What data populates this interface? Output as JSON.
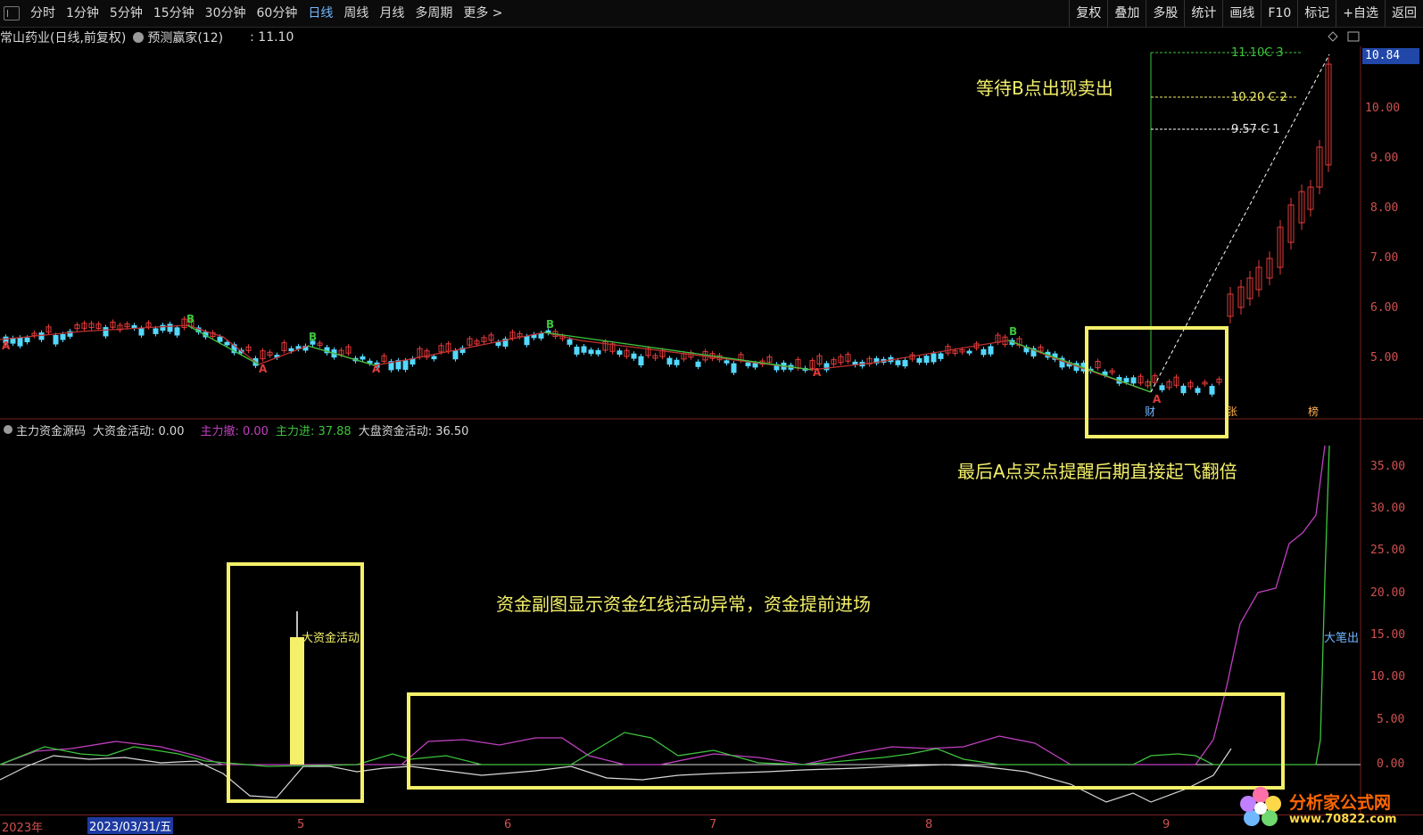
{
  "toolbar": {
    "periods": [
      "分时",
      "1分钟",
      "5分钟",
      "15分钟",
      "30分钟",
      "60分钟",
      "日线",
      "周线",
      "月线",
      "多周期",
      "更多 >"
    ],
    "active_period": "日线",
    "right_buttons": [
      "复权",
      "叠加",
      "多股",
      "统计",
      "画线",
      "F10",
      "标记",
      "+自选",
      "返回"
    ]
  },
  "info": {
    "stock_title": "常山药业(日线,前复权)",
    "indicator_name": "预测赢家(12)",
    "indicator_value": ": 11.10"
  },
  "price_box": "10.84",
  "price_axis": [
    "10.00",
    "9.00",
    "8.00",
    "7.00",
    "6.00",
    "5.00"
  ],
  "targets": [
    {
      "label": "11.10C 3",
      "value": 11.1
    },
    {
      "label": "10.20 C 2",
      "value": 10.2
    },
    {
      "label": "9.57 C 1",
      "value": 9.57
    }
  ],
  "signal_labels": {
    "buy": "A",
    "sell": "B"
  },
  "marks": {
    "cai": "财",
    "zhang": "张",
    "bang": "榜"
  },
  "sub_info": {
    "name": "主力资金源码",
    "big_activity": "大资金活动: 0.00",
    "main_out": "主力撤: 0.00",
    "main_in": "主力进: 37.88",
    "market_activity": "大盘资金活动: 36.50"
  },
  "sub_axis": [
    "35.00",
    "30.00",
    "25.00",
    "20.00",
    "15.00",
    "10.00",
    "5.00",
    "0.00"
  ],
  "sub_labels": {
    "big_fund": "大资金活动",
    "big_out": "大笔出"
  },
  "annotations": {
    "wait_b": "等待B点出现卖出",
    "last_a": "最后A点买点提醒后期直接起飞翻倍",
    "fund_note": "资金副图显示资金红线活动异常，资金提前进场"
  },
  "date_axis": {
    "year": "2023年",
    "cursor_date": "2023/03/31/五",
    "months": [
      "5",
      "6",
      "7",
      "8",
      "9"
    ]
  },
  "watermark": {
    "name": "分析家公式网",
    "url": "www.70822.com"
  },
  "colors": {
    "up": "#e03a3a",
    "down": "#54d8ff",
    "highlight": "#f4f06a",
    "purple": "#c040c0",
    "green": "#3cc43c"
  }
}
